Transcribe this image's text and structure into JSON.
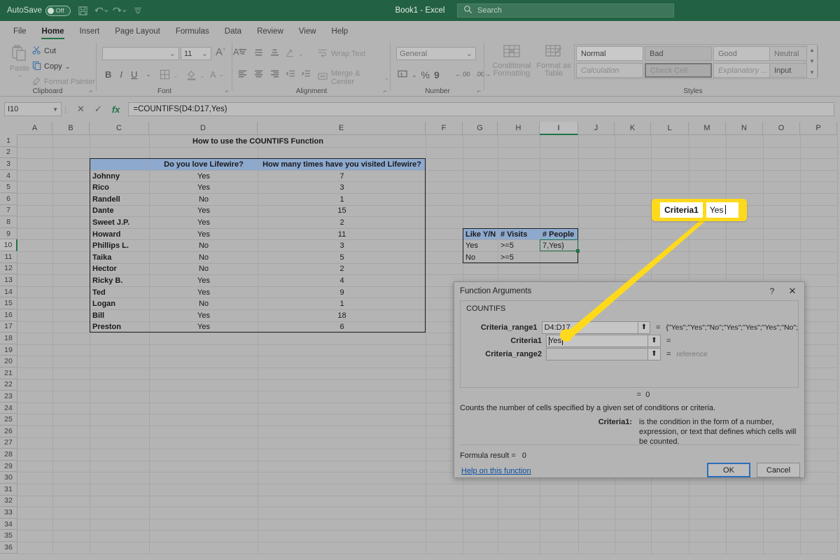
{
  "titlebar": {
    "autosave_label": "AutoSave",
    "autosave_state": "Off",
    "quick_access": [
      "save-icon",
      "undo-icon",
      "redo-icon",
      "customize-qat-icon"
    ],
    "window_title": "Book1  -  Excel",
    "search_placeholder": "Search"
  },
  "ribbon": {
    "tabs": [
      {
        "label": "File",
        "active": false
      },
      {
        "label": "Home",
        "active": true
      },
      {
        "label": "Insert",
        "active": false
      },
      {
        "label": "Page Layout",
        "active": false
      },
      {
        "label": "Formulas",
        "active": false
      },
      {
        "label": "Data",
        "active": false
      },
      {
        "label": "Review",
        "active": false
      },
      {
        "label": "View",
        "active": false
      },
      {
        "label": "Help",
        "active": false
      }
    ],
    "groups": {
      "clipboard": {
        "name": "Clipboard",
        "paste_label": "Paste",
        "cut_label": "Cut",
        "copy_label": "Copy",
        "format_painter_label": "Format Painter"
      },
      "font": {
        "name": "Font",
        "font_name_value": "",
        "font_size_value": "11",
        "grow_font": "A",
        "shrink_font": "A",
        "bold": "B",
        "italic": "I",
        "underline": "U"
      },
      "alignment": {
        "name": "Alignment",
        "wrap_text_label": "Wrap Text",
        "merge_center_label": "Merge & Center"
      },
      "number": {
        "name": "Number",
        "format_value": "General",
        "percent": "%",
        "comma": "9"
      },
      "styles": {
        "name": "Styles",
        "conditional_formatting_label": "Conditional Formatting",
        "format_as_table_label": "Format as Table",
        "cells": [
          "Normal",
          "Bad",
          "Good",
          "Neutral",
          "Calculation",
          "Check Cell",
          "Explanatory ...",
          "Input"
        ]
      }
    }
  },
  "formula_bar": {
    "name_box": "I10",
    "cancel_icon": "cancel-icon",
    "enter_icon": "enter-icon",
    "fx_icon": "insert-function-icon",
    "formula": "=COUNTIFS(D4:D17,Yes)"
  },
  "grid": {
    "columns": [
      "A",
      "B",
      "C",
      "D",
      "E",
      "F",
      "G",
      "H",
      "I",
      "J",
      "K",
      "L",
      "M",
      "N",
      "O",
      "P"
    ],
    "selected_column": "I",
    "selected_row": 10,
    "rows": [
      1,
      2,
      3,
      4,
      5,
      6,
      7,
      8,
      9,
      10,
      11,
      12,
      13,
      14,
      15,
      16,
      17,
      18,
      19,
      20,
      21,
      22,
      23,
      24,
      25,
      26,
      27,
      28,
      29,
      30,
      31,
      32,
      33,
      34,
      35,
      36
    ],
    "title_cell": {
      "ref": "C1",
      "text": "How to use the COUNTIFS Function"
    },
    "main_table": {
      "headers": [
        "",
        "Do you love Lifewire?",
        "How many times have you visited Lifewire?"
      ],
      "header_row": 3,
      "rows": [
        {
          "row": 4,
          "name": "Johnny",
          "love": "Yes",
          "visits": "7"
        },
        {
          "row": 5,
          "name": "Rico",
          "love": "Yes",
          "visits": "3"
        },
        {
          "row": 6,
          "name": "Randell",
          "love": "No",
          "visits": "1"
        },
        {
          "row": 7,
          "name": "Dante",
          "love": "Yes",
          "visits": "15"
        },
        {
          "row": 8,
          "name": "Sweet J.P.",
          "love": "Yes",
          "visits": "2"
        },
        {
          "row": 9,
          "name": "Howard",
          "love": "Yes",
          "visits": "11"
        },
        {
          "row": 10,
          "name": "Phillips L.",
          "love": "No",
          "visits": "3"
        },
        {
          "row": 11,
          "name": "Taika",
          "love": "No",
          "visits": "5"
        },
        {
          "row": 12,
          "name": "Hector",
          "love": "No",
          "visits": "2"
        },
        {
          "row": 13,
          "name": "Ricky B.",
          "love": "Yes",
          "visits": "4"
        },
        {
          "row": 14,
          "name": "Ted",
          "love": "Yes",
          "visits": "9"
        },
        {
          "row": 15,
          "name": "Logan",
          "love": "No",
          "visits": "1"
        },
        {
          "row": 16,
          "name": "Bill",
          "love": "Yes",
          "visits": "18"
        },
        {
          "row": 17,
          "name": "Preston",
          "love": "Yes",
          "visits": "6"
        }
      ]
    },
    "summary_table": {
      "headers": [
        "Like Y/N",
        "# Visits",
        "# People"
      ],
      "header_row": 9,
      "rows": [
        {
          "row": 10,
          "like": "Yes",
          "visits": ">=5",
          "people": "7,Yes)"
        },
        {
          "row": 11,
          "like": "No",
          "visits": ">=5",
          "people": ""
        }
      ]
    }
  },
  "callout": {
    "label": "Criteria1",
    "value": "Yes",
    "color": "#ffd91c"
  },
  "dialog": {
    "title": "Function Arguments",
    "help_icon": "help-icon",
    "close_icon": "close-icon",
    "function_name": "COUNTIFS",
    "args": [
      {
        "label": "Criteria_range1",
        "value": "D4:D17",
        "result": "{\"Yes\";\"Yes\";\"No\";\"Yes\";\"Yes\";\"Yes\";\"No\";",
        "disabled": false,
        "focused": false
      },
      {
        "label": "Criteria1",
        "value": "Yes",
        "result": "",
        "disabled": false,
        "focused": true
      },
      {
        "label": "Criteria_range2",
        "value": "",
        "result": "reference",
        "disabled": true,
        "focused": false
      }
    ],
    "interim_result": "0",
    "description": "Counts the number of cells specified by a given set of conditions or criteria.",
    "arg_help_label": "Criteria1:",
    "arg_help_text": "is the condition in the form of a number, expression, or text that defines which cells will be counted.",
    "formula_result_label": "Formula result =",
    "formula_result_value": "0",
    "help_link": "Help on this function",
    "ok_label": "OK",
    "cancel_label": "Cancel"
  }
}
